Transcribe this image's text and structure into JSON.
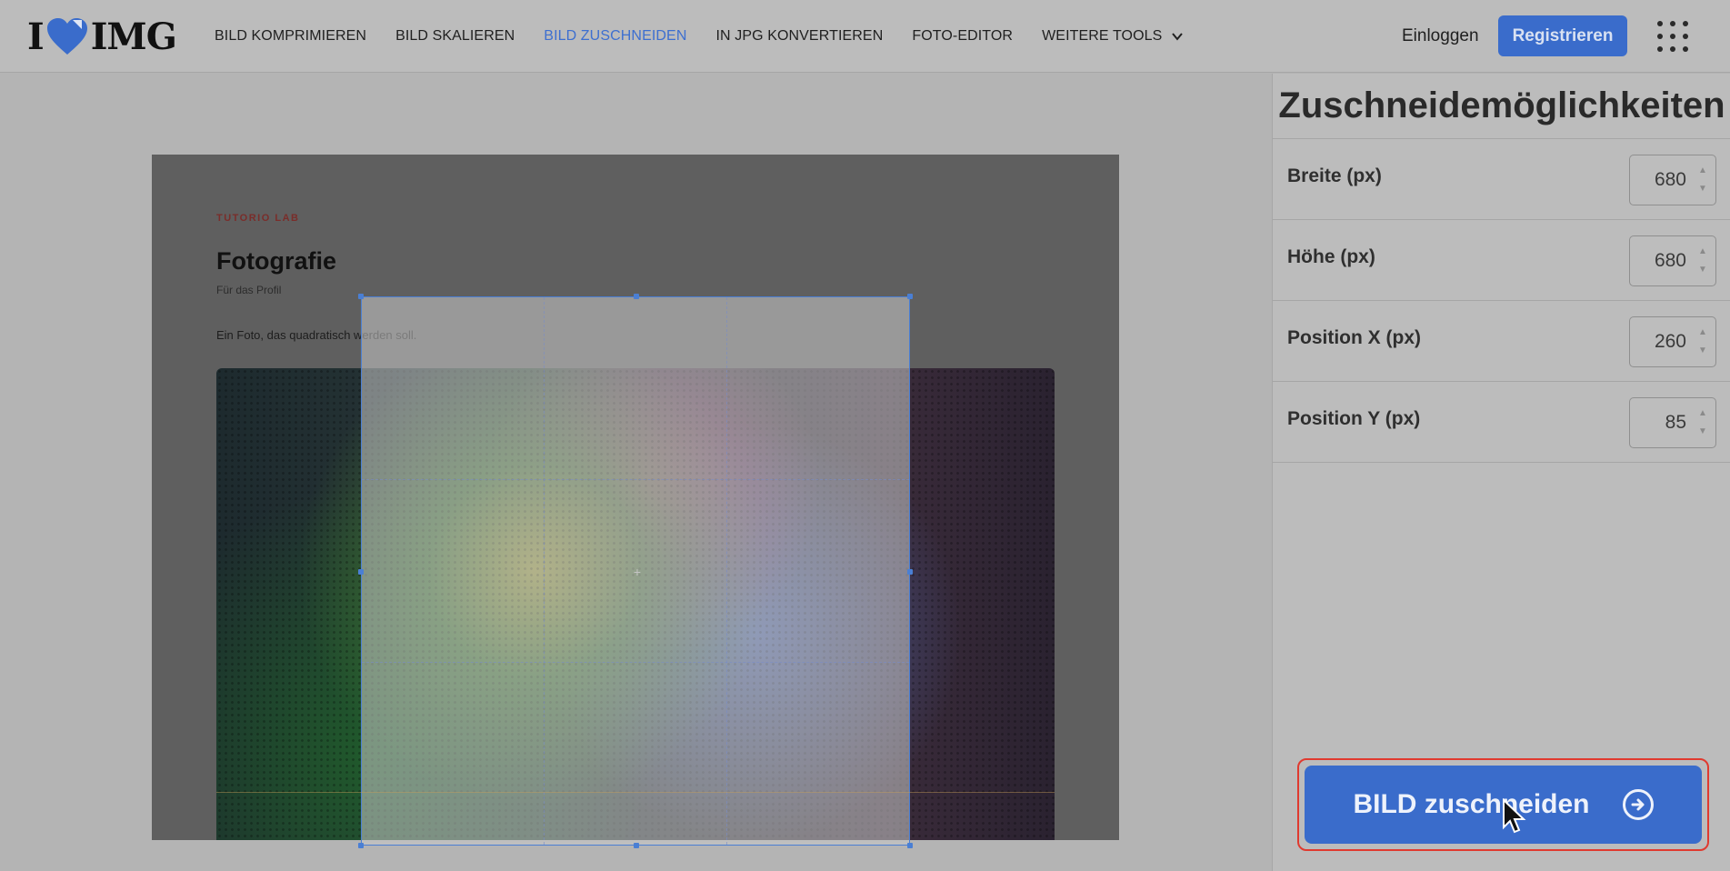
{
  "header": {
    "logo_left": "I",
    "logo_right": "IMG",
    "nav": [
      {
        "label": "BILD KOMPRIMIEREN"
      },
      {
        "label": "BILD SKALIEREN"
      },
      {
        "label": "BILD ZUSCHNEIDEN",
        "active": true
      },
      {
        "label": "IN JPG KONVERTIEREN"
      },
      {
        "label": "FOTO-EDITOR"
      },
      {
        "label": "WEITERE TOOLS"
      }
    ],
    "login": "Einloggen",
    "register": "Registrieren"
  },
  "document": {
    "kicker": "TUTORIO LAB",
    "title": "Fotografie",
    "subtitle": "Für das Profil",
    "text": "Ein Foto, das quadratisch werden soll."
  },
  "panel": {
    "title": "Zuschneidemöglichkeiten",
    "options": [
      {
        "label": "Breite (px)",
        "value": "680"
      },
      {
        "label": "Höhe (px)",
        "value": "680"
      },
      {
        "label": "Position X (px)",
        "value": "260"
      },
      {
        "label": "Position Y (px)",
        "value": "85"
      }
    ],
    "action": "BILD zuschneiden"
  },
  "colors": {
    "accent": "#3a6ccb",
    "active_nav": "#3d6fd0",
    "highlight_border": "#e03a2f"
  }
}
